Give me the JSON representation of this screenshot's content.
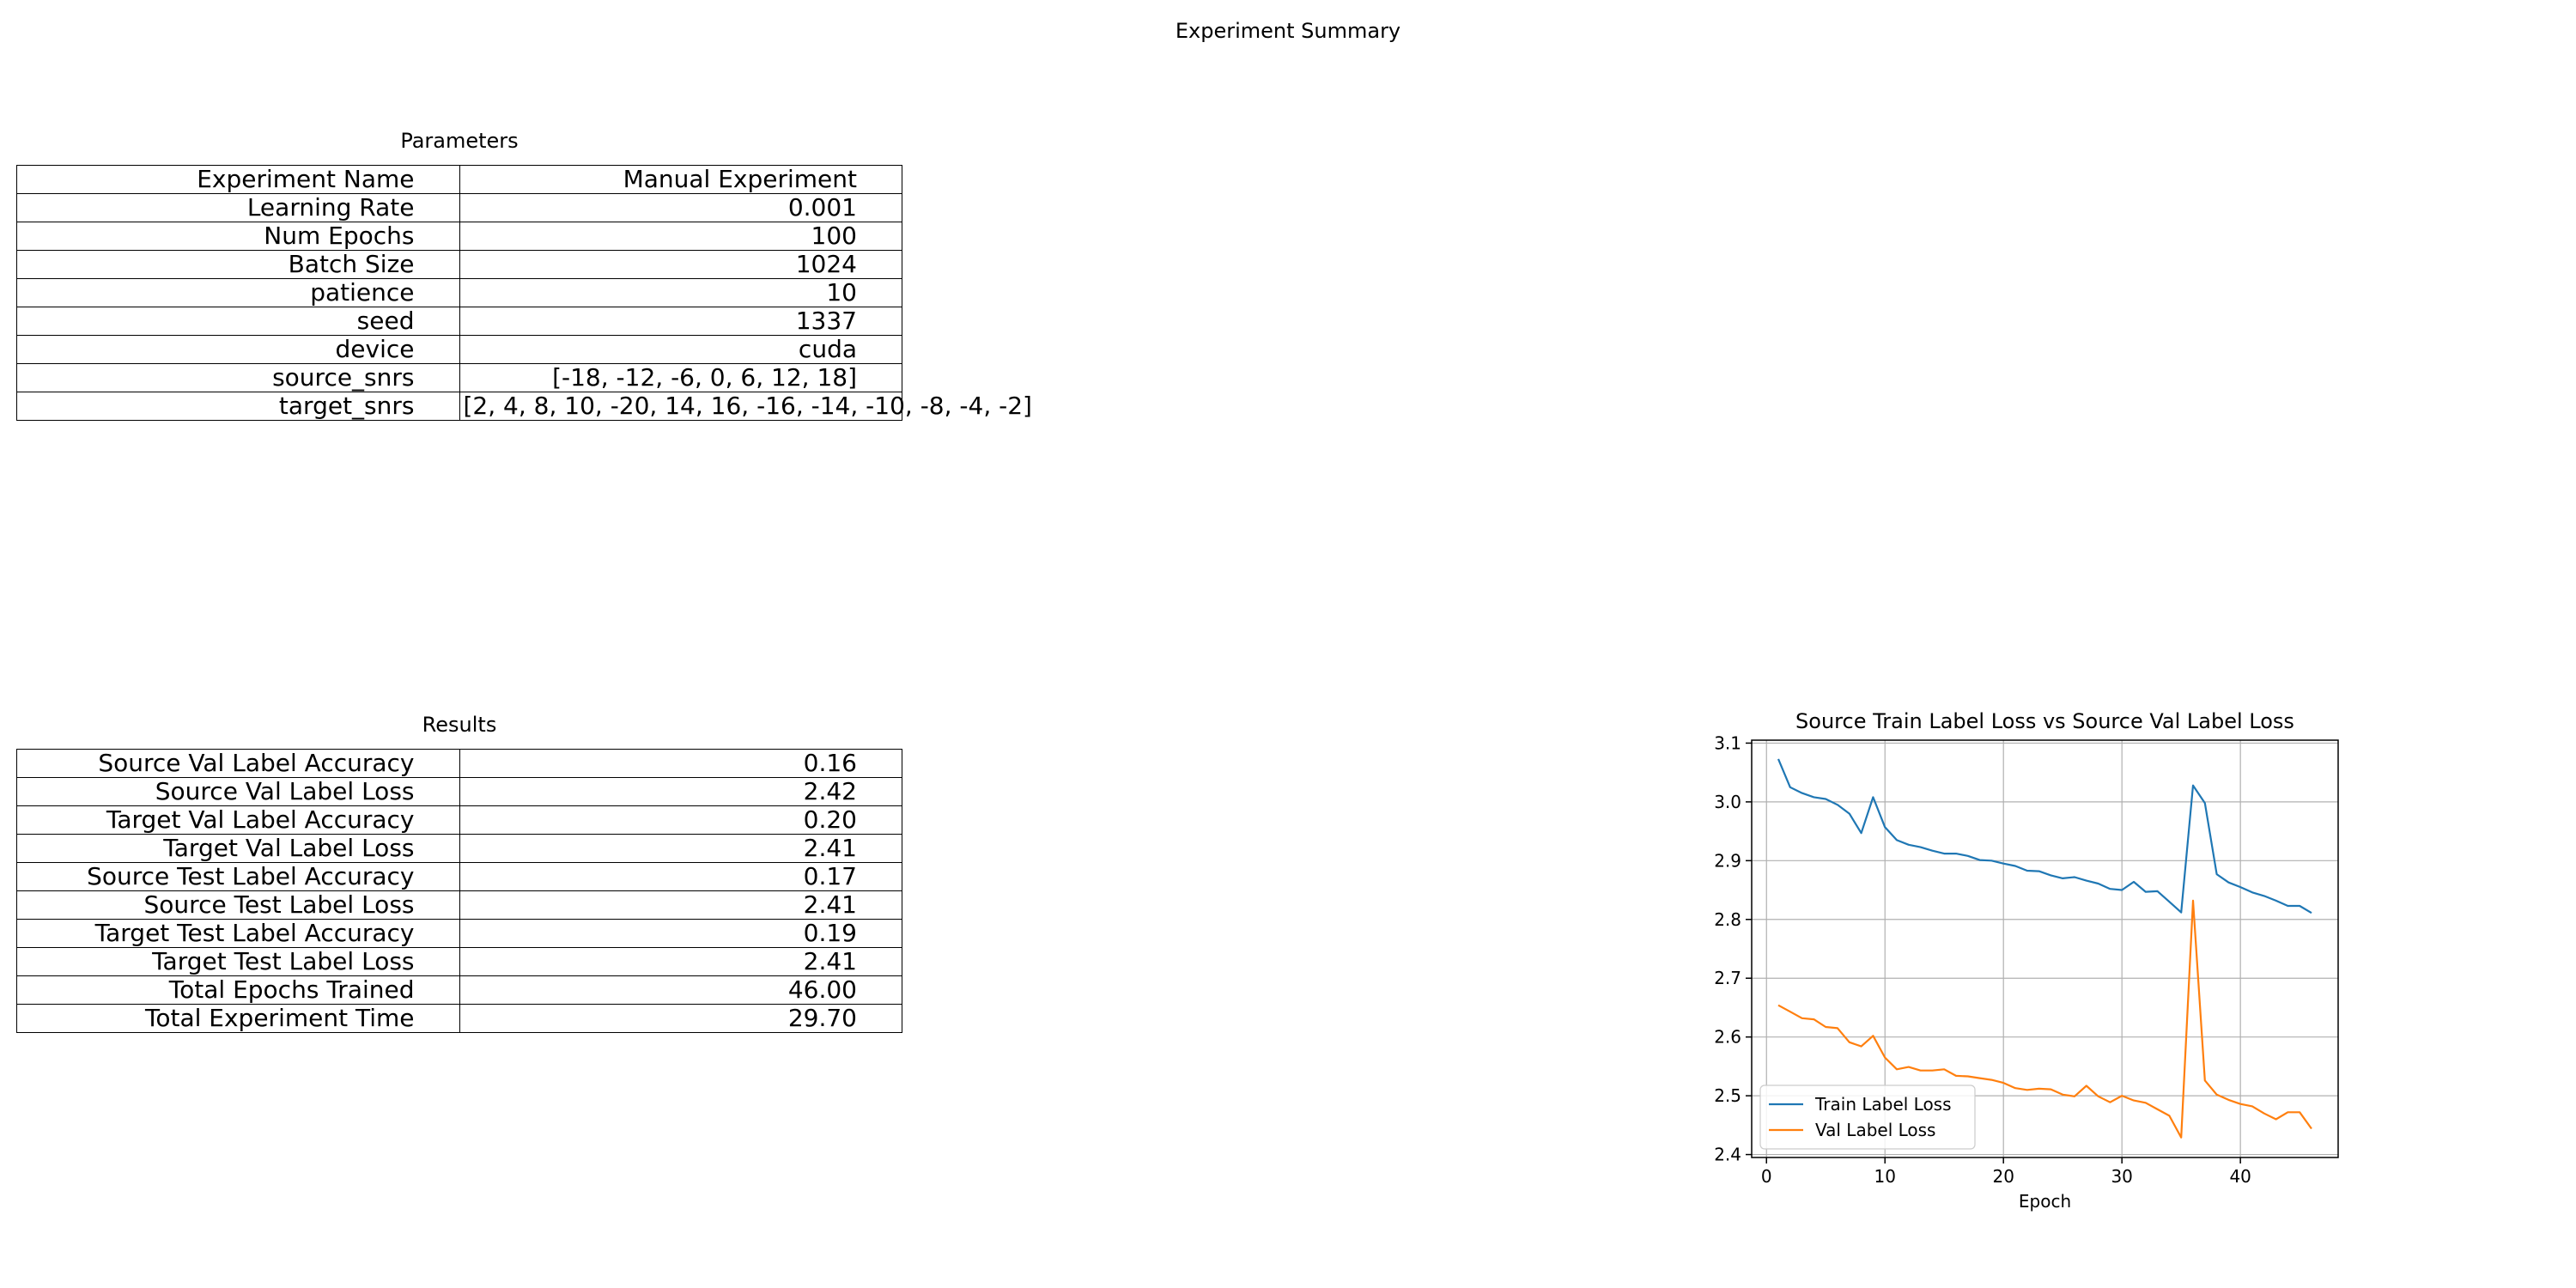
{
  "page": {
    "title": "Experiment Summary"
  },
  "parameters": {
    "title": "Parameters",
    "rows": [
      {
        "key": "Experiment Name",
        "value": "Manual Experiment"
      },
      {
        "key": "Learning Rate",
        "value": "0.001"
      },
      {
        "key": "Num Epochs",
        "value": "100"
      },
      {
        "key": "Batch Size",
        "value": "1024"
      },
      {
        "key": "patience",
        "value": "10"
      },
      {
        "key": "seed",
        "value": "1337"
      },
      {
        "key": "device",
        "value": "cuda"
      },
      {
        "key": "source_snrs",
        "value": "[-18, -12, -6, 0, 6, 12, 18]"
      },
      {
        "key": "target_snrs",
        "value": "[2, 4, 8, 10, -20, 14, 16, -16, -14, -10, -8, -4, -2]"
      }
    ]
  },
  "results": {
    "title": "Results",
    "rows": [
      {
        "key": "Source Val Label Accuracy",
        "value": "0.16"
      },
      {
        "key": "Source Val Label Loss",
        "value": "2.42"
      },
      {
        "key": "Target Val Label Accuracy",
        "value": "0.20"
      },
      {
        "key": "Target Val Label Loss",
        "value": "2.41"
      },
      {
        "key": "Source Test Label Accuracy",
        "value": "0.17"
      },
      {
        "key": "Source Test Label Loss",
        "value": "2.41"
      },
      {
        "key": "Target Test Label Accuracy",
        "value": "0.19"
      },
      {
        "key": "Target Test Label Loss",
        "value": "2.41"
      },
      {
        "key": "Total Epochs Trained",
        "value": "46.00"
      },
      {
        "key": "Total Experiment Time",
        "value": "29.70"
      }
    ]
  },
  "chart_data": {
    "type": "line",
    "title": "Source Train Label Loss vs Source Val Label Loss",
    "xlabel": "Epoch",
    "ylabel": "",
    "xlim": [
      -1.25,
      48.25
    ],
    "ylim": [
      2.395,
      3.105
    ],
    "xticks": [
      0,
      10,
      20,
      30,
      40
    ],
    "yticks": [
      2.4,
      2.5,
      2.6,
      2.7,
      2.8,
      2.9,
      3.0,
      3.1
    ],
    "ytick_labels": [
      "2.4",
      "2.5",
      "2.6",
      "2.7",
      "2.8",
      "2.9",
      "3.0",
      "3.1"
    ],
    "grid": true,
    "legend_position": "lower-left",
    "x": [
      1,
      2,
      3,
      4,
      5,
      6,
      7,
      8,
      9,
      10,
      11,
      12,
      13,
      14,
      15,
      16,
      17,
      18,
      19,
      20,
      21,
      22,
      23,
      24,
      25,
      26,
      27,
      28,
      29,
      30,
      31,
      32,
      33,
      34,
      35,
      36,
      37,
      38,
      39,
      40,
      41,
      42,
      43,
      44,
      45,
      46
    ],
    "series": [
      {
        "name": "Train Label Loss",
        "color": "#1f77b4",
        "values": [
          3.073,
          3.025,
          3.015,
          3.008,
          3.005,
          2.995,
          2.98,
          2.947,
          3.008,
          2.957,
          2.935,
          2.927,
          2.923,
          2.917,
          2.912,
          2.912,
          2.908,
          2.901,
          2.9,
          2.895,
          2.891,
          2.883,
          2.882,
          2.875,
          2.87,
          2.872,
          2.866,
          2.861,
          2.852,
          2.85,
          2.864,
          2.847,
          2.848,
          2.83,
          2.812,
          3.028,
          2.998,
          2.877,
          2.863,
          2.855,
          2.846,
          2.84,
          2.832,
          2.823,
          2.823,
          2.811
        ]
      },
      {
        "name": "Val Label Loss",
        "color": "#ff7f0e",
        "values": [
          2.654,
          2.643,
          2.632,
          2.63,
          2.617,
          2.615,
          2.591,
          2.584,
          2.602,
          2.565,
          2.545,
          2.549,
          2.543,
          2.543,
          2.545,
          2.534,
          2.533,
          2.53,
          2.527,
          2.522,
          2.513,
          2.51,
          2.512,
          2.511,
          2.502,
          2.499,
          2.517,
          2.499,
          2.489,
          2.5,
          2.492,
          2.488,
          2.477,
          2.466,
          2.429,
          2.832,
          2.526,
          2.502,
          2.493,
          2.486,
          2.482,
          2.47,
          2.46,
          2.472,
          2.472,
          2.444
        ]
      }
    ]
  }
}
